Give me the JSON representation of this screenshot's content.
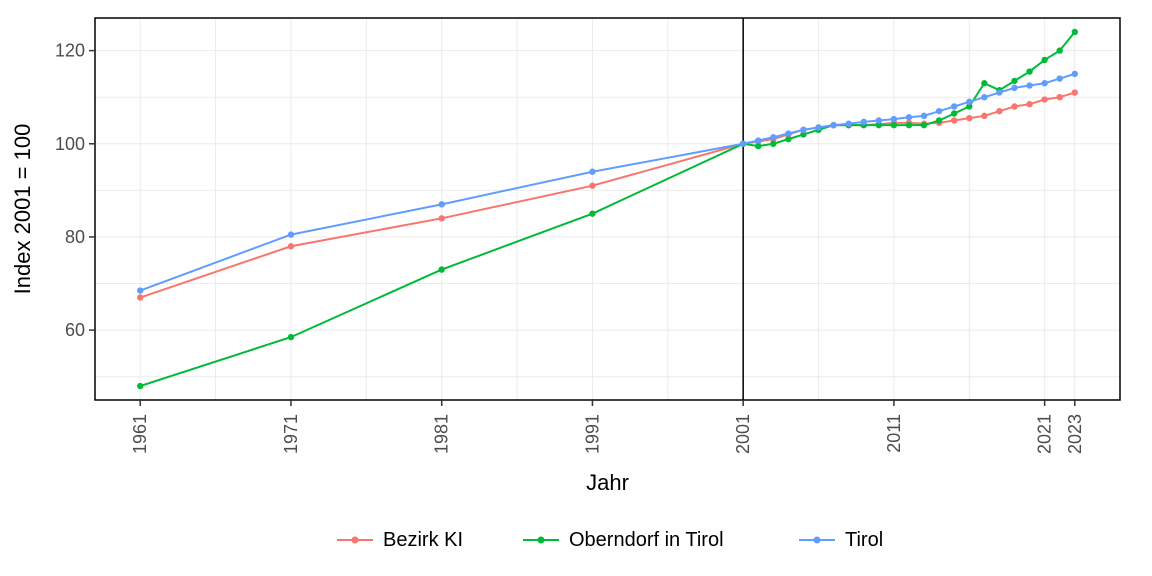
{
  "chart_data": {
    "type": "line",
    "title": "",
    "xlabel": "Jahr",
    "ylabel": "Index 2001 = 100",
    "vline_x": 2001,
    "xlim": [
      1958,
      2026
    ],
    "ylim": [
      45,
      127
    ],
    "y_ticks": [
      60,
      80,
      100,
      120
    ],
    "x_ticks": [
      1961,
      1971,
      1981,
      1991,
      2001,
      2011,
      2021,
      2023
    ],
    "series": [
      {
        "name": "Bezirk KI",
        "color": "#f8766d",
        "x": [
          1961,
          1971,
          1981,
          1991,
          2001,
          2002,
          2003,
          2004,
          2005,
          2006,
          2007,
          2008,
          2009,
          2010,
          2011,
          2012,
          2013,
          2014,
          2015,
          2016,
          2017,
          2018,
          2019,
          2020,
          2021,
          2022,
          2023
        ],
        "y": [
          67,
          78,
          84,
          91,
          100,
          100.5,
          101,
          102,
          103,
          103.5,
          104,
          104,
          104,
          104.2,
          104.5,
          104.5,
          104.3,
          104.5,
          105,
          105.5,
          106,
          107,
          108,
          108.5,
          109.5,
          110,
          111
        ]
      },
      {
        "name": "Oberndorf in Tirol",
        "color": "#00ba38",
        "x": [
          1961,
          1971,
          1981,
          1991,
          2001,
          2002,
          2003,
          2004,
          2005,
          2006,
          2007,
          2008,
          2009,
          2010,
          2011,
          2012,
          2013,
          2014,
          2015,
          2016,
          2017,
          2018,
          2019,
          2020,
          2021,
          2022,
          2023
        ],
        "y": [
          48,
          58.5,
          73,
          85,
          100,
          99.5,
          100,
          101,
          102,
          103,
          104,
          104,
          104,
          104,
          104,
          104,
          104,
          105,
          106.5,
          108,
          113,
          111.5,
          113.5,
          115.5,
          118,
          120,
          124
        ]
      },
      {
        "name": "Tirol",
        "color": "#619cff",
        "x": [
          1961,
          1971,
          1981,
          1991,
          2001,
          2002,
          2003,
          2004,
          2005,
          2006,
          2007,
          2008,
          2009,
          2010,
          2011,
          2012,
          2013,
          2014,
          2015,
          2016,
          2017,
          2018,
          2019,
          2020,
          2021,
          2022,
          2023
        ],
        "y": [
          68.5,
          80.5,
          87,
          94,
          100,
          100.7,
          101.4,
          102.2,
          103,
          103.5,
          104,
          104.3,
          104.7,
          105,
          105.3,
          105.7,
          106,
          107,
          108,
          109,
          110,
          111,
          112,
          112.5,
          113,
          114,
          115
        ]
      }
    ],
    "legend_position": "bottom"
  }
}
